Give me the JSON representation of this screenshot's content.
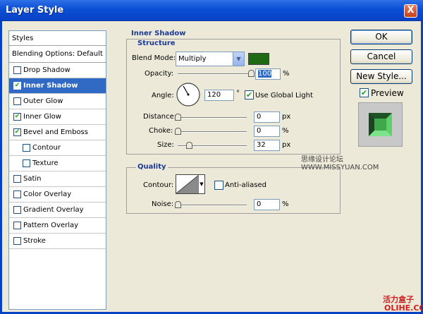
{
  "window": {
    "title": "Layer Style",
    "close_label": "X"
  },
  "left_panel": {
    "header": "Styles",
    "blending_options": "Blending Options: Default",
    "items": [
      {
        "label": "Drop Shadow",
        "checked": false,
        "selected": false,
        "sub": false
      },
      {
        "label": "Inner Shadow",
        "checked": true,
        "selected": true,
        "sub": false
      },
      {
        "label": "Outer Glow",
        "checked": false,
        "selected": false,
        "sub": false
      },
      {
        "label": "Inner Glow",
        "checked": true,
        "selected": false,
        "sub": false
      },
      {
        "label": "Bevel and Emboss",
        "checked": true,
        "selected": false,
        "sub": false
      },
      {
        "label": "Contour",
        "checked": false,
        "selected": false,
        "sub": true
      },
      {
        "label": "Texture",
        "checked": false,
        "selected": false,
        "sub": true
      },
      {
        "label": "Satin",
        "checked": false,
        "selected": false,
        "sub": false
      },
      {
        "label": "Color Overlay",
        "checked": false,
        "selected": false,
        "sub": false
      },
      {
        "label": "Gradient Overlay",
        "checked": false,
        "selected": false,
        "sub": false
      },
      {
        "label": "Pattern Overlay",
        "checked": false,
        "selected": false,
        "sub": false
      },
      {
        "label": "Stroke",
        "checked": false,
        "selected": false,
        "sub": false
      }
    ]
  },
  "inner_shadow": {
    "section_title": "Inner Shadow",
    "structure_title": "Structure",
    "blend_mode_label": "Blend Mode:",
    "blend_mode_value": "Multiply",
    "shadow_color": "#1f6a13",
    "opacity_label": "Opacity:",
    "opacity_value": "100",
    "opacity_unit": "%",
    "opacity_level": 1.0,
    "angle_label": "Angle:",
    "angle_value": "120",
    "angle_unit": "°",
    "use_global_light_label": "Use Global Light",
    "use_global_light_checked": true,
    "distance_label": "Distance:",
    "distance_value": "0",
    "distance_unit": "px",
    "distance_level": 0.0,
    "choke_label": "Choke:",
    "choke_value": "0",
    "choke_unit": "%",
    "choke_level": 0.0,
    "size_label": "Size:",
    "size_value": "32",
    "size_unit": "px",
    "size_level": 0.16
  },
  "quality": {
    "title": "Quality",
    "contour_label": "Contour:",
    "anti_aliased_label": "Anti-aliased",
    "anti_aliased_checked": false,
    "noise_label": "Noise:",
    "noise_value": "0",
    "noise_unit": "%",
    "noise_level": 0.0
  },
  "buttons": {
    "ok": "OK",
    "cancel": "Cancel",
    "new_style": "New Style...",
    "preview_label": "Preview",
    "preview_checked": true
  },
  "watermarks": {
    "site": "思缘设计论坛  WWW.MISSYUAN.COM",
    "brand_cn": "活力盒子",
    "brand_en": "OLIHE.COM"
  },
  "icons": {
    "checkmark": "checkmark-icon",
    "dropdown": "chevron-down-icon",
    "close": "close-icon"
  }
}
